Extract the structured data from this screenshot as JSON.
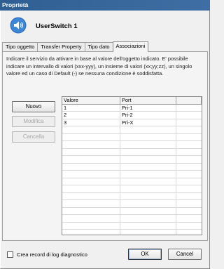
{
  "window": {
    "title": "Proprietà"
  },
  "header": {
    "icon": "speaker-icon",
    "title": "UserSwitch 1"
  },
  "tabs": [
    {
      "label": "Tipo oggetto",
      "active": false
    },
    {
      "label": "Transfer Property",
      "active": false
    },
    {
      "label": "Tipo dato",
      "active": false
    },
    {
      "label": "Associazioni",
      "active": true
    }
  ],
  "description": "Indicare il servizio da attivare in base al valore dell'oggetto indicato. E' possibile indicare un intervallo di valori (xxx-yyy), un insieme di valori (xx;yy;zz), un singolo valore ed un caso di Default (-) se nessuna condizione è soddisfatta.",
  "buttons": {
    "new": "Nuovo",
    "edit": "Modifica",
    "delete": "Cancella"
  },
  "table": {
    "columns": [
      "Valore",
      "Port",
      ""
    ],
    "rows": [
      {
        "valore": "1",
        "port": "Pri-1"
      },
      {
        "valore": "2",
        "port": "Pri-2"
      },
      {
        "valore": "3",
        "port": "Pri-X"
      }
    ]
  },
  "footer": {
    "checkbox_label": "Crea record di log diagnostico",
    "checkbox_checked": false,
    "ok": "OK",
    "cancel": "Cancel"
  }
}
